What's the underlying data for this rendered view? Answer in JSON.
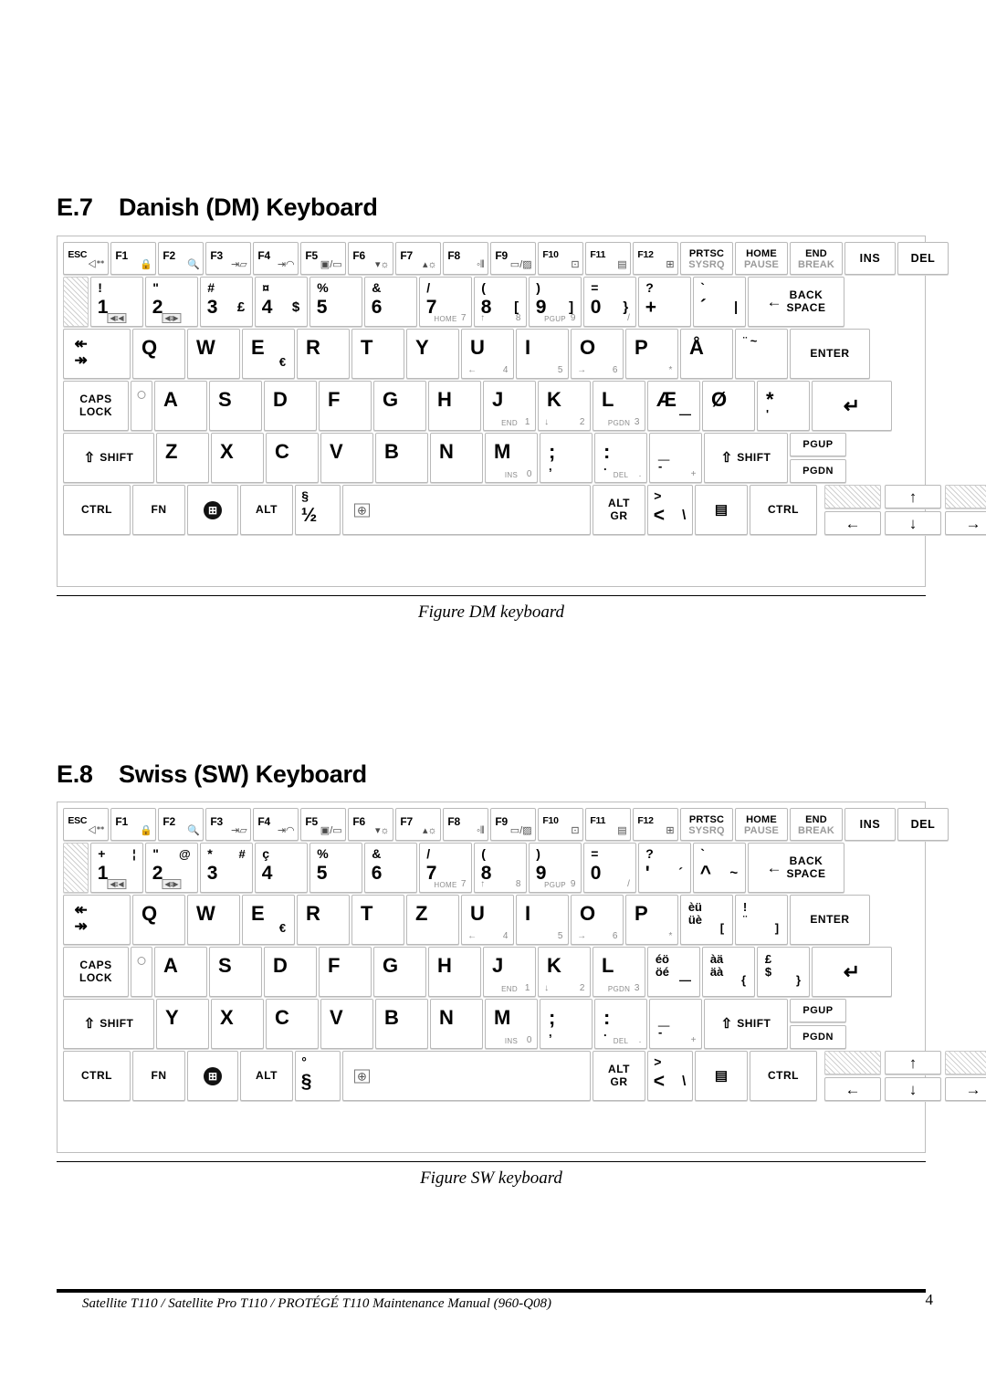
{
  "document": {
    "footer_text": "Satellite T110 / Satellite Pro T110 / PROTÉGÉ T110 Maintenance Manual (960-Q08)",
    "page_number": "4"
  },
  "sections": [
    {
      "number": "E.7",
      "title": "Danish (DM) Keyboard",
      "caption": "Figure DM keyboard"
    },
    {
      "number": "E.8",
      "title": "Swiss (SW) Keyboard",
      "caption": "Figure SW keyboard"
    }
  ],
  "keyboards": {
    "danish": {
      "function_row": [
        {
          "label": "ESC",
          "icon": "speaker-mute-icon",
          "glyph": "◁×"
        },
        {
          "label": "F1",
          "icon": "lock-icon",
          "glyph": "🔒"
        },
        {
          "label": "F2",
          "icon": "magnifier-icon",
          "glyph": "🔍"
        },
        {
          "label": "F3",
          "icon": "sleep-icon",
          "glyph": "⇥☾"
        },
        {
          "label": "F4",
          "icon": "hibernate-icon",
          "glyph": "⇥◯"
        },
        {
          "label": "F5",
          "icon": "display-switch-icon",
          "glyph": "▣/▭"
        },
        {
          "label": "F6",
          "icon": "brightness-down-icon",
          "glyph": "▼☼"
        },
        {
          "label": "F7",
          "icon": "brightness-up-icon",
          "glyph": "▲☼"
        },
        {
          "label": "F8",
          "icon": "wireless-icon",
          "glyph": "((¶))"
        },
        {
          "label": "F9",
          "icon": "touchpad-icon",
          "glyph": "▭/▨"
        },
        {
          "label": "F10",
          "icon": "cursor-overlay-icon",
          "glyph": "⊡"
        },
        {
          "label": "F11",
          "icon": "numeric-keypad-icon",
          "glyph": "▤"
        },
        {
          "label": "F12",
          "icon": "scroll-lock-icon",
          "glyph": "⊞"
        },
        {
          "label": "PRTSC",
          "label2": "SYSRQ",
          "icon": "print-screen-key"
        },
        {
          "label": "HOME",
          "label2": "PAUSE",
          "icon": "home-pause-key"
        },
        {
          "label": "END",
          "label2": "BREAK",
          "icon": "end-break-key"
        },
        {
          "label": "INS",
          "icon": "insert-key"
        },
        {
          "label": "DEL",
          "icon": "delete-key"
        }
      ],
      "number_row": [
        {
          "main": "1",
          "up": "!",
          "fn": "volume-down-icon"
        },
        {
          "main": "2",
          "up": "\"",
          "fn": "volume-up-icon"
        },
        {
          "main": "3",
          "up": "#",
          "alt": "£"
        },
        {
          "main": "4",
          "up": "¤",
          "alt": "$"
        },
        {
          "main": "5",
          "up": "%"
        },
        {
          "main": "6",
          "up": "&"
        },
        {
          "main": "7",
          "up": "/",
          "fnlabel": "HOME",
          "fnnum": "7"
        },
        {
          "main": "8",
          "up": "(",
          "alt": "[",
          "fnleft": "↑",
          "fnnum": "8"
        },
        {
          "main": "9",
          "up": ")",
          "alt": "]",
          "fnlabel": "PGUP",
          "fnnum": "9"
        },
        {
          "main": "0",
          "up": "=",
          "alt": "}",
          "fnright": "/"
        },
        {
          "main": "+",
          "up": "?"
        },
        {
          "main": "´",
          "up": "`",
          "alt": "|"
        },
        {
          "main": "BACK SPACE",
          "icon": "backspace-key"
        }
      ],
      "letter_row_1": [
        {
          "label": "TAB",
          "icon": "tab-key"
        },
        {
          "main": "Q"
        },
        {
          "main": "W"
        },
        {
          "main": "E",
          "alt": "€"
        },
        {
          "main": "R"
        },
        {
          "main": "T"
        },
        {
          "main": "Y"
        },
        {
          "main": "U",
          "fnleft": "←",
          "fnnum": "4"
        },
        {
          "main": "I",
          "fnnum": "5"
        },
        {
          "main": "O",
          "fnleft": "→",
          "fnnum": "6"
        },
        {
          "main": "P",
          "fnnum": "*"
        },
        {
          "main": "Å"
        },
        {
          "main": "^",
          "stack": "¨ ~"
        },
        {
          "main": "ENTER",
          "icon": "enter-key"
        }
      ],
      "letter_row_2": [
        {
          "label": "CAPS LOCK",
          "icon": "caps-lock-key"
        },
        {
          "indicator": "caps-lock-led"
        },
        {
          "main": "A"
        },
        {
          "main": "S"
        },
        {
          "main": "D"
        },
        {
          "main": "F"
        },
        {
          "main": "G"
        },
        {
          "main": "H"
        },
        {
          "main": "J",
          "fnlabel": "END",
          "fnnum": "1"
        },
        {
          "main": "K",
          "fnleft": "↓",
          "fnnum": "2"
        },
        {
          "main": "L",
          "fnlabel": "PGDN",
          "fnnum": "3"
        },
        {
          "main": "Æ",
          "alt": "—"
        },
        {
          "main": "Ø"
        },
        {
          "main": "*",
          "sub": "'"
        },
        {
          "main": "↵",
          "icon": "enter-key"
        }
      ],
      "letter_row_3": [
        {
          "label": "SHIFT",
          "icon": "shift-key"
        },
        {
          "main": "Z"
        },
        {
          "main": "X"
        },
        {
          "main": "C"
        },
        {
          "main": "V"
        },
        {
          "main": "B"
        },
        {
          "main": "N"
        },
        {
          "main": "M",
          "fnlabel": "INS",
          "fnnum": "0"
        },
        {
          "main": ";",
          "sub": ","
        },
        {
          "main": ":",
          "sub": ".",
          "fnlabel": "DEL",
          "fnnum": "."
        },
        {
          "main": "_",
          "sub": "-",
          "fnnum": "+"
        },
        {
          "label": "SHIFT",
          "icon": "shift-key"
        },
        {
          "label": "PGUP",
          "icon": "page-up-key"
        },
        {
          "label": "PGDN",
          "icon": "page-down-key"
        }
      ],
      "bottom_row": [
        {
          "label": "CTRL",
          "icon": "control-key"
        },
        {
          "label": "FN",
          "icon": "function-key"
        },
        {
          "label": "",
          "icon": "windows-key"
        },
        {
          "label": "ALT",
          "icon": "alt-key"
        },
        {
          "main": "½",
          "up": "§"
        },
        {
          "label": "",
          "icon": "space-bar"
        },
        {
          "label": "ALT GR",
          "icon": "alt-gr-key"
        },
        {
          "main": "<",
          "up": ">",
          "alt": "\\"
        },
        {
          "label": "",
          "icon": "application-menu-key"
        },
        {
          "label": "CTRL",
          "icon": "control-key"
        },
        {
          "label": "↑",
          "icon": "arrow-up-key"
        },
        {
          "label": "←",
          "icon": "arrow-left-key"
        },
        {
          "label": "↓",
          "icon": "arrow-down-key"
        },
        {
          "label": "→",
          "icon": "arrow-right-key"
        }
      ]
    },
    "swiss": {
      "number_row": [
        {
          "main": "1",
          "up": "+",
          "alt2": "¦",
          "fn": "volume-down-icon"
        },
        {
          "main": "2",
          "up": "\"",
          "alt2": "@",
          "fn": "volume-up-icon"
        },
        {
          "main": "3",
          "up": "*",
          "alt2": "#"
        },
        {
          "main": "4",
          "up": "ç"
        },
        {
          "main": "5",
          "up": "%"
        },
        {
          "main": "6",
          "up": "&"
        },
        {
          "main": "7",
          "up": "/",
          "fnlabel": "HOME",
          "fnnum": "7"
        },
        {
          "main": "8",
          "up": "(",
          "fnleft": "↑",
          "fnnum": "8"
        },
        {
          "main": "9",
          "up": ")",
          "fnlabel": "PGUP",
          "fnnum": "9"
        },
        {
          "main": "0",
          "up": "=",
          "fnright": "/"
        },
        {
          "main": "'",
          "up": "?",
          "alt": "´"
        },
        {
          "main": "^",
          "up": "`",
          "alt": "~"
        },
        {
          "main": "BACK SPACE",
          "icon": "backspace-key"
        }
      ],
      "letter_row_1": [
        {
          "label": "TAB",
          "icon": "tab-key"
        },
        {
          "main": "Q"
        },
        {
          "main": "W"
        },
        {
          "main": "E",
          "alt": "€"
        },
        {
          "main": "R"
        },
        {
          "main": "T"
        },
        {
          "main": "Z"
        },
        {
          "main": "U",
          "fnleft": "←",
          "fnnum": "4"
        },
        {
          "main": "I",
          "fnnum": "5"
        },
        {
          "main": "O",
          "fnleft": "→",
          "fnnum": "6"
        },
        {
          "main": "P",
          "fnnum": "*"
        },
        {
          "stack": "èü",
          "stack2": "üè",
          "alt": "["
        },
        {
          "stack": "!",
          "stack2": "¨",
          "alt": "]"
        },
        {
          "main": "ENTER",
          "icon": "enter-key"
        }
      ],
      "letter_row_2": [
        {
          "label": "CAPS LOCK",
          "icon": "caps-lock-key"
        },
        {
          "indicator": "caps-lock-led"
        },
        {
          "main": "A"
        },
        {
          "main": "S"
        },
        {
          "main": "D"
        },
        {
          "main": "F"
        },
        {
          "main": "G"
        },
        {
          "main": "H"
        },
        {
          "main": "J",
          "fnlabel": "END",
          "fnnum": "1"
        },
        {
          "main": "K",
          "fnleft": "↓",
          "fnnum": "2"
        },
        {
          "main": "L",
          "fnlabel": "PGDN",
          "fnnum": "3"
        },
        {
          "stack": "éö",
          "stack2": "öé",
          "alt": "—"
        },
        {
          "stack": "àä",
          "stack2": "äà",
          "alt": "{"
        },
        {
          "stack": "£",
          "stack2": "$",
          "alt": "}"
        },
        {
          "main": "↵",
          "icon": "enter-key"
        }
      ],
      "letter_row_3": [
        {
          "label": "SHIFT",
          "icon": "shift-key"
        },
        {
          "main": "Y"
        },
        {
          "main": "X"
        },
        {
          "main": "C"
        },
        {
          "main": "V"
        },
        {
          "main": "B"
        },
        {
          "main": "N"
        },
        {
          "main": "M",
          "fnlabel": "INS",
          "fnnum": "0"
        },
        {
          "main": ";",
          "sub": ","
        },
        {
          "main": ":",
          "sub": ".",
          "fnlabel": "DEL",
          "fnnum": "."
        },
        {
          "main": "_",
          "sub": "-",
          "fnnum": "+"
        },
        {
          "label": "SHIFT",
          "icon": "shift-key"
        },
        {
          "label": "PGUP",
          "icon": "page-up-key"
        },
        {
          "label": "PGDN",
          "icon": "page-down-key"
        }
      ],
      "bottom_row": [
        {
          "label": "CTRL",
          "icon": "control-key"
        },
        {
          "label": "FN",
          "icon": "function-key"
        },
        {
          "label": "",
          "icon": "windows-key"
        },
        {
          "label": "ALT",
          "icon": "alt-key"
        },
        {
          "main": "§",
          "up": "°"
        },
        {
          "label": "",
          "icon": "space-bar"
        },
        {
          "label": "ALT GR",
          "icon": "alt-gr-key"
        },
        {
          "main": "<",
          "up": ">",
          "alt": "\\"
        },
        {
          "label": "",
          "icon": "application-menu-key"
        },
        {
          "label": "CTRL",
          "icon": "control-key"
        },
        {
          "label": "↑",
          "icon": "arrow-up-key"
        },
        {
          "label": "←",
          "icon": "arrow-left-key"
        },
        {
          "label": "↓",
          "icon": "arrow-down-key"
        },
        {
          "label": "→",
          "icon": "arrow-right-key"
        }
      ]
    }
  }
}
